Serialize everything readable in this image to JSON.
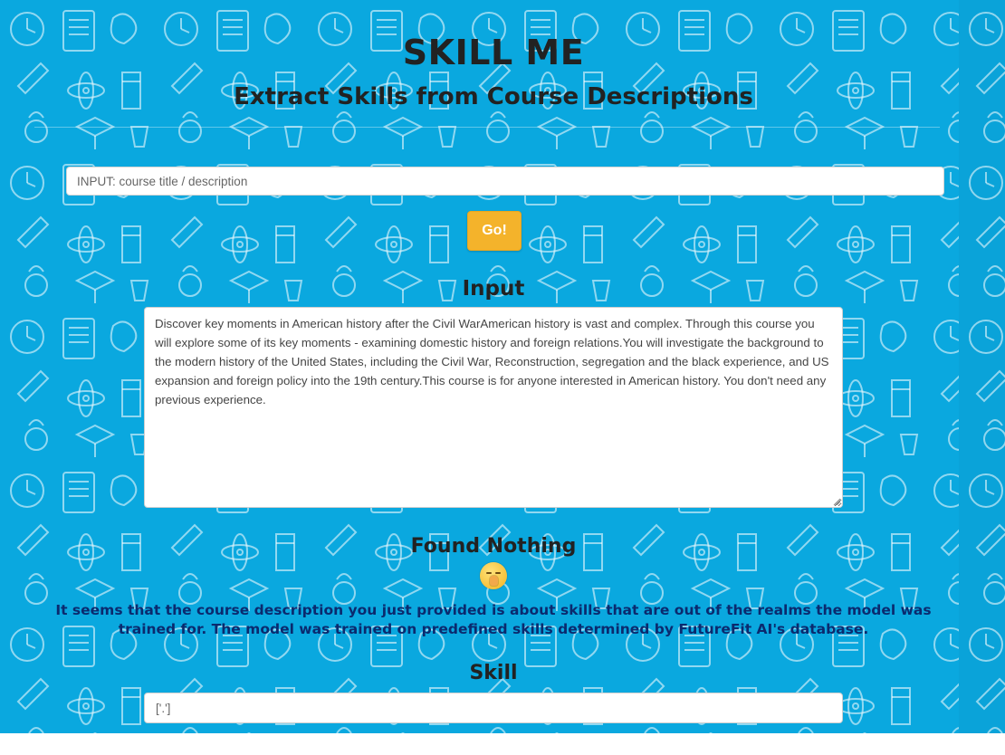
{
  "header": {
    "title": "SKILL ME",
    "subtitle": "Extract Skills from Course Descriptions"
  },
  "search": {
    "placeholder": "INPUT: course title / description",
    "value": ""
  },
  "go_button": {
    "label": "Go!"
  },
  "input_section": {
    "heading": "Input",
    "description": "Discover key moments in American history after the Civil WarAmerican history is vast and complex. Through this course you will explore some of its key moments - examining domestic history and foreign relations.You will investigate the background to the modern history of the United States, including the Civil War, Reconstruction, segregation and the black experience, and US expansion and foreign policy into the 19th century.This course is for anyone interested in American history. You don't need any previous experience."
  },
  "result": {
    "heading": "Found Nothing",
    "emoji_icon": "shushing-face-icon",
    "message": "It seems that the course description you just provided is about skills that are out of the realms the model was trained for. The model was trained on predefined skills determined by FutureFit AI's database."
  },
  "skill_section": {
    "heading": "Skill",
    "value": "['.']"
  },
  "colors": {
    "background": "#0aa8df",
    "button": "#f4b32b",
    "heading_text": "#222222",
    "message_text": "#0b2a6e"
  }
}
